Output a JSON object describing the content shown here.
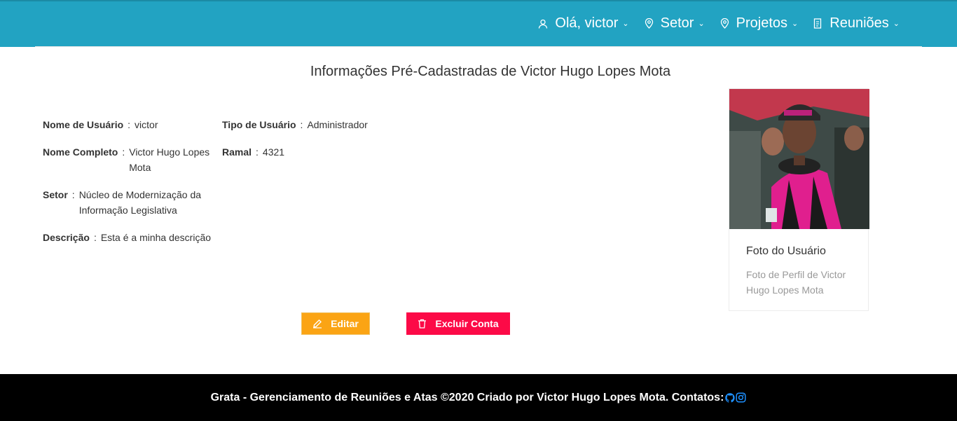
{
  "nav": {
    "greeting": "Olá, victor",
    "setor": "Setor",
    "projetos": "Projetos",
    "reunioes": "Reuniões",
    "chevron": "⌄"
  },
  "page": {
    "title": "Informações Pré-Cadastradas de Victor Hugo Lopes Mota"
  },
  "fields": {
    "username": {
      "label": "Nome de Usuário",
      "sep": ":",
      "value": "victor"
    },
    "user_type": {
      "label": "Tipo de Usuário",
      "sep": ":",
      "value": "Administrador"
    },
    "full_name": {
      "label": "Nome Completo",
      "sep": ":",
      "value": "Victor Hugo Lopes Mota"
    },
    "ramal": {
      "label": "Ramal",
      "sep": ":",
      "value": "4321"
    },
    "setor": {
      "label": "Setor",
      "sep": ":",
      "value": "Núcleo de Modernização da Informação Legislativa"
    },
    "descricao": {
      "label": "Descrição",
      "sep": ":",
      "value": "Esta é a minha descrição"
    }
  },
  "card": {
    "title": "Foto do Usuário",
    "description": "Foto de Perfil de Victor Hugo Lopes Mota"
  },
  "actions": {
    "edit": "Editar",
    "delete": "Excluir Conta"
  },
  "footer": {
    "text": "Grata - Gerenciamento de Reuniões e Atas ©2020 Criado por Victor Hugo Lopes Mota. Contatos:",
    "icons": [
      "github-icon",
      "instagram-icon"
    ]
  },
  "colors": {
    "header": "#22a3c2",
    "edit_button": "#fba414",
    "delete_button": "#fc0a47",
    "footer": "#000000",
    "contact_icons": "#1e90ff"
  }
}
